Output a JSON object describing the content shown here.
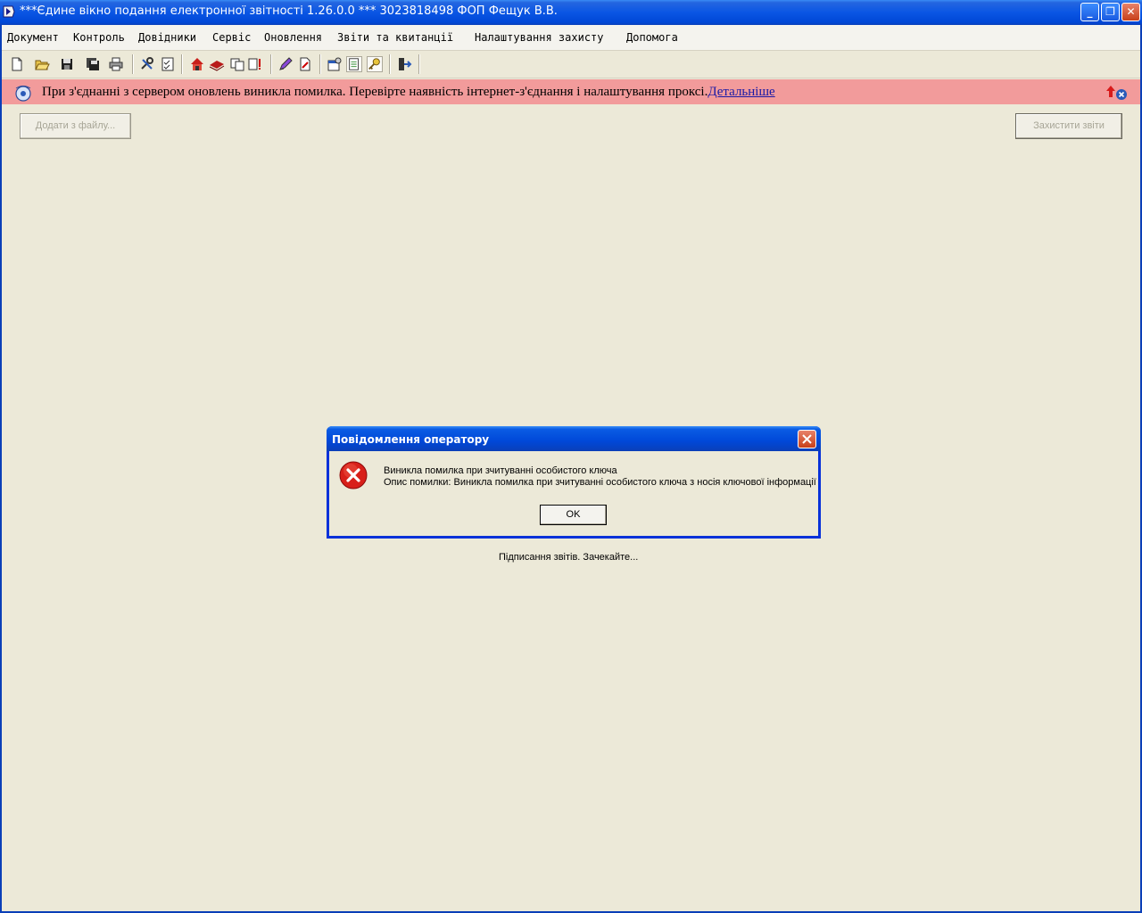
{
  "window": {
    "title": "***Єдине вікно подання електронної звітності 1.26.0.0 *** 3023818498 ФОП Фещук В.В.",
    "minimize": "_",
    "restore": "❐",
    "close": "✕"
  },
  "menu": [
    "Документ",
    "Контроль",
    "Довідники",
    "Сервіс",
    "Оновлення",
    "Звіти та квитанції",
    "Налаштування захисту",
    "Допомога"
  ],
  "toolbar": {
    "icons": [
      "new-doc-icon",
      "open-folder-icon",
      "save-icon",
      "save-all-icon",
      "print-icon",
      "tools-icon",
      "checklist-icon",
      "home-icon",
      "book-icon",
      "copy-icon",
      "warning-doc-icon",
      "edit-icon",
      "pdf-icon",
      "settings-window-icon",
      "document-list-icon",
      "key-icon",
      "exit-icon"
    ]
  },
  "banner": {
    "message": "При з'єднанні з сервером оновлень виникла помилка. Перевірте наявність інтернет-з'єднання і налаштування проксі.",
    "link": "Детальніше"
  },
  "buttons": {
    "add_from_file": "Додати з файлу...",
    "protect_reports": "Захистити звіти"
  },
  "dialog": {
    "title": "Повідомлення оператору",
    "line1": "Виникла помилка при зчитуванні особистого ключа",
    "line2": "Опис помилки: Виникла помилка при зчитуванні особистого ключа з носія ключової інформації",
    "ok": "OK"
  },
  "status": "Підписання звітів. Зачекайте..."
}
